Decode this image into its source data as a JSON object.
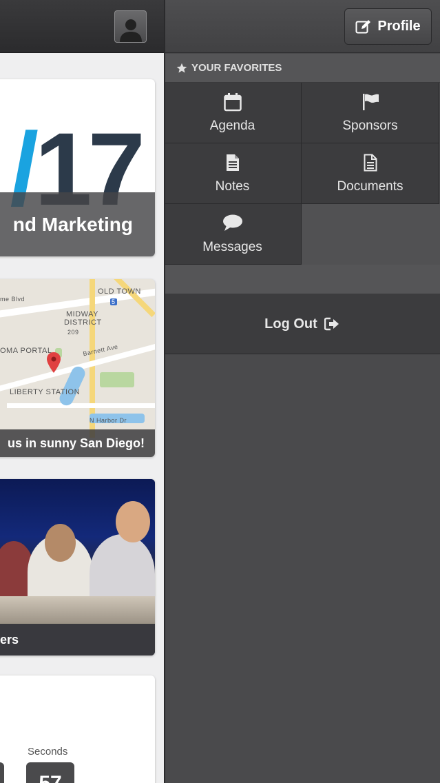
{
  "main": {
    "hero": {
      "big_text_slash": "/",
      "big_text_number": "17",
      "banner": "nd Marketing"
    },
    "map": {
      "labels": [
        "OLD TOWN",
        "MIDWAY",
        "DISTRICT",
        "OMA PORTAL",
        "LIBERTY STATION",
        "Barnett Ave",
        "N Harbor Dr",
        "209",
        "5",
        "me Blvd"
      ],
      "banner": "us in sunny San Diego!"
    },
    "photo": {
      "banner": "kers"
    },
    "countdown": {
      "colon": ":",
      "seconds_label": "Seconds",
      "seconds_value": "57"
    }
  },
  "menu": {
    "profile_label": "Profile",
    "favorites_header": "YOUR FAVORITES",
    "favorites": [
      {
        "label": "Agenda",
        "icon": "calendar-icon"
      },
      {
        "label": "Sponsors",
        "icon": "flag-icon"
      },
      {
        "label": "Notes",
        "icon": "note-icon"
      },
      {
        "label": "Documents",
        "icon": "document-icon"
      },
      {
        "label": "Messages",
        "icon": "chat-bubble-icon"
      }
    ],
    "logout_label": "Log Out"
  },
  "colors": {
    "menu_bg": "#4a4a4c",
    "tile_bg": "#3c3c3e",
    "accent_blue": "#1aa3e0",
    "content_bg": "#efeff0"
  }
}
